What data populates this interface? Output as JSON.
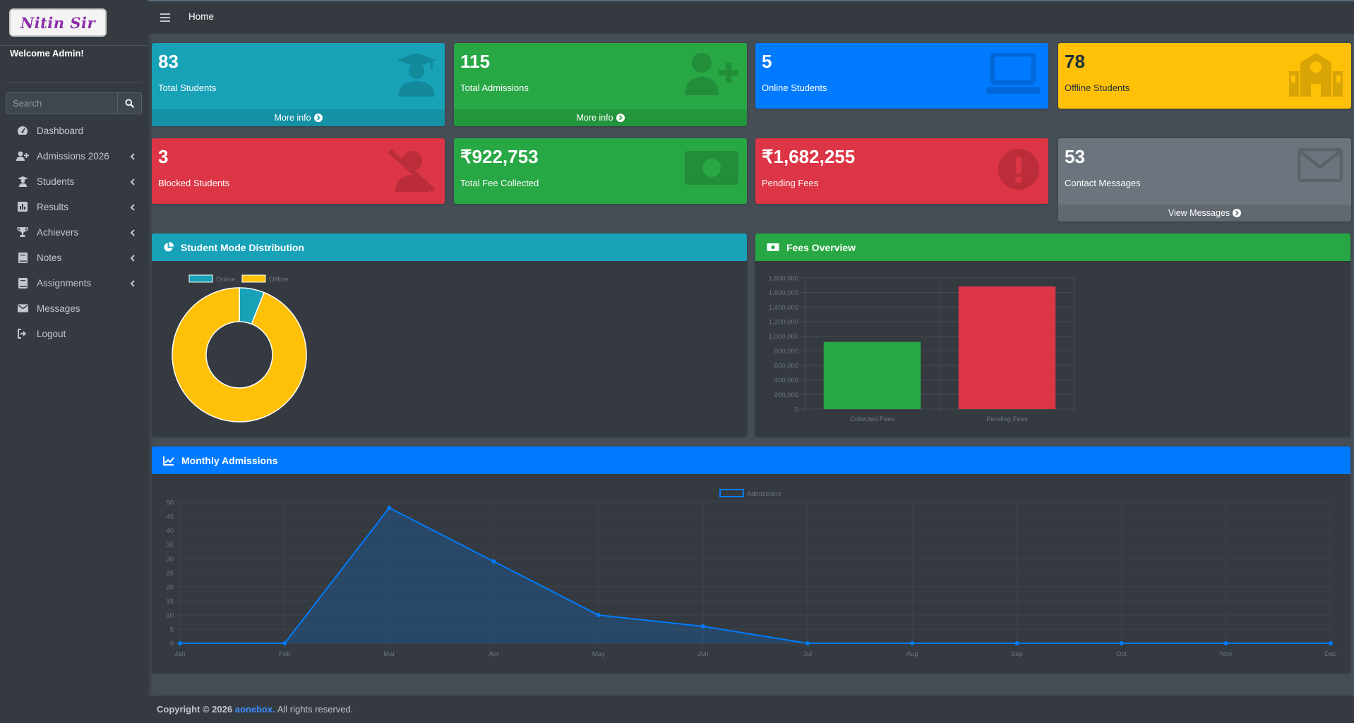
{
  "sidebar": {
    "logo_text": "Nitin Sir",
    "welcome": "Welcome Admin!",
    "search_placeholder": "Search",
    "items": [
      {
        "label": "Dashboard",
        "icon": "tachometer-icon",
        "has_chevron": false
      },
      {
        "label": "Admissions 2026",
        "icon": "user-plus-icon",
        "has_chevron": true
      },
      {
        "label": "Students",
        "icon": "graduate-icon",
        "has_chevron": true
      },
      {
        "label": "Results",
        "icon": "chart-bar-icon",
        "has_chevron": true
      },
      {
        "label": "Achievers",
        "icon": "trophy-icon",
        "has_chevron": true
      },
      {
        "label": "Notes",
        "icon": "book-icon",
        "has_chevron": true
      },
      {
        "label": "Assignments",
        "icon": "book-icon",
        "has_chevron": true
      },
      {
        "label": "Messages",
        "icon": "envelope-icon",
        "has_chevron": false
      },
      {
        "label": "Logout",
        "icon": "sign-out-icon",
        "has_chevron": false
      }
    ]
  },
  "topbar": {
    "home": "Home"
  },
  "stats": [
    {
      "value": "83",
      "label": "Total Students",
      "color": "#17a2b8",
      "footer": "More info",
      "icon": "graduate-icon"
    },
    {
      "value": "115",
      "label": "Total Admissions",
      "color": "#28a745",
      "footer": "More info",
      "icon": "user-plus-icon"
    },
    {
      "value": "5",
      "label": "Online Students",
      "color": "#007bff",
      "icon": "laptop-icon"
    },
    {
      "value": "78",
      "label": "Offline Students",
      "color": "#ffc107",
      "icon": "school-icon"
    },
    {
      "value": "3",
      "label": "Blocked Students",
      "color": "#dc3545",
      "icon": "user-slash-icon"
    },
    {
      "value": "₹922,753",
      "label": "Total Fee Collected",
      "color": "#28a745",
      "icon": "money-bill-icon"
    },
    {
      "value": "₹1,682,255",
      "label": "Pending Fees",
      "color": "#dc3545",
      "icon": "exclamation-circle-icon"
    },
    {
      "value": "53",
      "label": "Contact Messages",
      "color": "#6c757d",
      "footer": "View Messages",
      "icon": "envelope-icon"
    }
  ],
  "cards": {
    "mode": {
      "title": "Student Mode Distribution",
      "color": "#17a2b8"
    },
    "fees": {
      "title": "Fees Overview",
      "color": "#28a745"
    },
    "monthly": {
      "title": "Monthly Admissions",
      "color": "#007bff"
    }
  },
  "footer": {
    "prefix": "Copyright © 2026 ",
    "brand": "aonebox.",
    "suffix": " All rights reserved."
  },
  "chart_data": [
    {
      "type": "pie",
      "title": "Student Mode Distribution",
      "categories": [
        "Online",
        "Offline"
      ],
      "values": [
        5,
        78
      ],
      "colors": [
        "#17a2b8",
        "#ffc107"
      ],
      "legend": "top"
    },
    {
      "type": "bar",
      "title": "Fees Overview",
      "categories": [
        "Collected Fees",
        "Pending Fees"
      ],
      "values": [
        922753,
        1682255
      ],
      "colors": [
        "#28a745",
        "#dc3545"
      ],
      "ylim": [
        0,
        1800000
      ],
      "yticks": [
        "0",
        "200,000",
        "400,000",
        "600,000",
        "800,000",
        "1,000,000",
        "1,200,000",
        "1,400,000",
        "1,600,000",
        "1,800,000"
      ],
      "grid": true
    },
    {
      "type": "area",
      "title": "Monthly Admissions",
      "categories": [
        "Jan",
        "Feb",
        "Mar",
        "Apr",
        "May",
        "Jun",
        "Jul",
        "Aug",
        "Sep",
        "Oct",
        "Nov",
        "Dec"
      ],
      "series": [
        {
          "name": "Admissions",
          "values": [
            0,
            0,
            48,
            29,
            10,
            6,
            0,
            0,
            0,
            0,
            0,
            0
          ],
          "color": "#007bff"
        }
      ],
      "ylim": [
        0,
        50
      ],
      "yticks": [
        "0",
        "5",
        "10",
        "15",
        "20",
        "25",
        "30",
        "35",
        "40",
        "45",
        "50"
      ],
      "grid": true,
      "legend": "top"
    }
  ]
}
